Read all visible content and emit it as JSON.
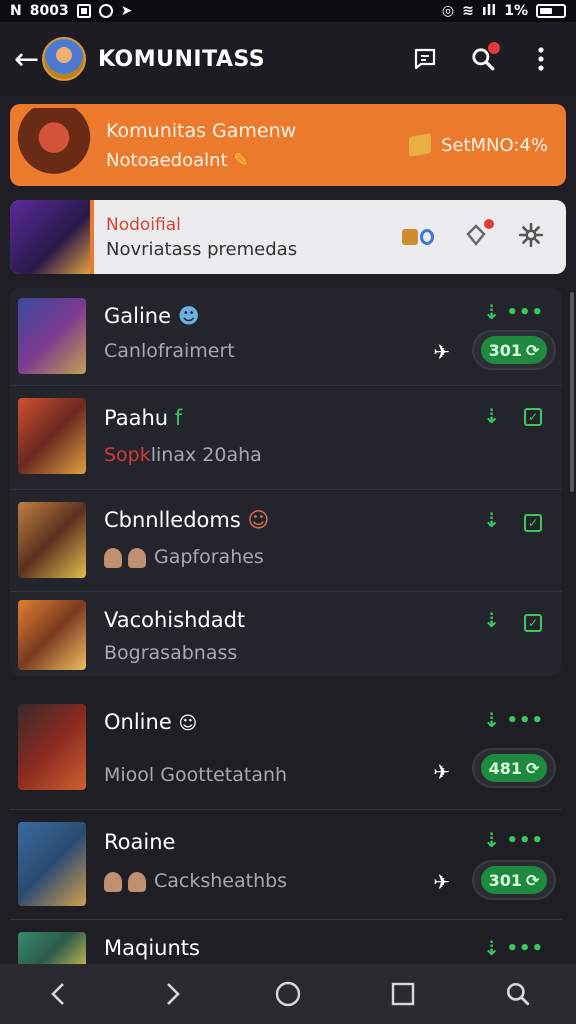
{
  "status_bar": {
    "left_text": "8003",
    "right_text": "1%"
  },
  "app_bar": {
    "title": "KOMUNITASS"
  },
  "highlight_cards": [
    {
      "title": "Komunitas Gamenw",
      "subtitle": "Notoaedoalnt",
      "stat": "SetMNO:4%"
    },
    {
      "title": "Nodoifial",
      "subtitle": "Novriatass premedas"
    }
  ],
  "list_items": [
    {
      "title": "Galine",
      "subtitle": "Canlofraimert",
      "pill": "301"
    },
    {
      "title": "Paahu",
      "title_badge": "f",
      "subtitle": "Sopk",
      "subtitle_rest": "linax 20aha"
    },
    {
      "title": "Cbnnlledoms",
      "subtitle": "Gapforahes"
    },
    {
      "title": "Vacohishdadt",
      "subtitle": "Bograsabnass"
    },
    {
      "title": "Online",
      "subtitle": "Miool Goottetatanh",
      "pill": "481"
    },
    {
      "title": "Roaine",
      "subtitle": "Cacksheathbs",
      "pill": "301"
    },
    {
      "title": "Maqiunts"
    }
  ],
  "colors": {
    "accent_orange": "#ec7a2c",
    "accent_green": "#3ac85a",
    "badge_red": "#e03a3a"
  },
  "icons": [
    "back-arrow-icon",
    "chat-icon",
    "search-icon",
    "more-vert-icon",
    "download-icon",
    "more-horiz-icon",
    "check-icon",
    "like-icon",
    "settings-icon"
  ]
}
